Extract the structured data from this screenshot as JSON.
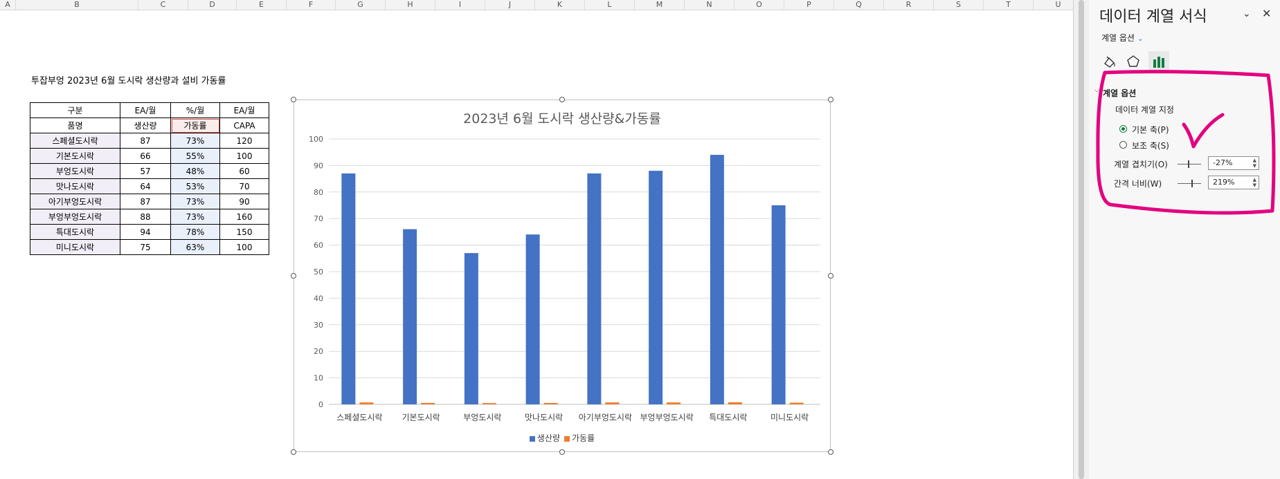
{
  "columns": [
    "A",
    "B",
    "C",
    "D",
    "E",
    "F",
    "G",
    "H",
    "I",
    "J",
    "K",
    "L",
    "M",
    "N",
    "O",
    "P",
    "Q",
    "R",
    "S",
    "T",
    "U"
  ],
  "sheet_title": "투잡부엉 2023년 6월 도시락 생산량과 설비 가동률",
  "table": {
    "header1": [
      "구분",
      "EA/월",
      "%/월",
      "EA/월"
    ],
    "header2": [
      "품명",
      "생산량",
      "가동률",
      "CAPA"
    ],
    "rows": [
      [
        "스페셜도시락",
        "87",
        "73%",
        "120"
      ],
      [
        "기본도시락",
        "66",
        "55%",
        "100"
      ],
      [
        "부엉도시락",
        "57",
        "48%",
        "60"
      ],
      [
        "맛나도시락",
        "64",
        "53%",
        "70"
      ],
      [
        "아기부엉도시락",
        "87",
        "73%",
        "90"
      ],
      [
        "부엉부엉도시락",
        "88",
        "73%",
        "160"
      ],
      [
        "특대도시락",
        "94",
        "78%",
        "150"
      ],
      [
        "미니도시락",
        "75",
        "63%",
        "100"
      ]
    ]
  },
  "chart_data": {
    "type": "bar",
    "title": "2023년 6월 도시락 생산량&가동률",
    "categories": [
      "스페셜도시락",
      "기본도시락",
      "부엉도시락",
      "맛나도시락",
      "아기부엉도시락",
      "부엉부엉도시락",
      "특대도시락",
      "미니도시락"
    ],
    "series": [
      {
        "name": "생산량",
        "values": [
          87,
          66,
          57,
          64,
          87,
          88,
          94,
          75
        ],
        "color": "#4472c4"
      },
      {
        "name": "가동률",
        "values": [
          0.73,
          0.55,
          0.48,
          0.53,
          0.73,
          0.73,
          0.78,
          0.63
        ],
        "color": "#ed7d31"
      }
    ],
    "ylim": [
      0,
      100
    ],
    "yticks": [
      0,
      10,
      20,
      30,
      40,
      50,
      60,
      70,
      80,
      90,
      100
    ],
    "grid": true,
    "legend_position": "bottom"
  },
  "pane": {
    "title": "데이터 계열 서식",
    "options_dropdown": "계열 옵션",
    "section_header": "계열 옵션",
    "plot_on_label": "데이터 계열 지정",
    "primary_axis": "기본 축(P)",
    "secondary_axis": "보조 축(S)",
    "overlap_label": "계열 겹치기(O)",
    "overlap_value": "-27%",
    "gap_label": "간격 너비(W)",
    "gap_value": "219%",
    "accent_color": "#107c41",
    "annotation_color": "#e4007f",
    "icons": [
      "fill-line-icon",
      "effects-pentagon-icon",
      "series-options-bar-icon"
    ]
  }
}
